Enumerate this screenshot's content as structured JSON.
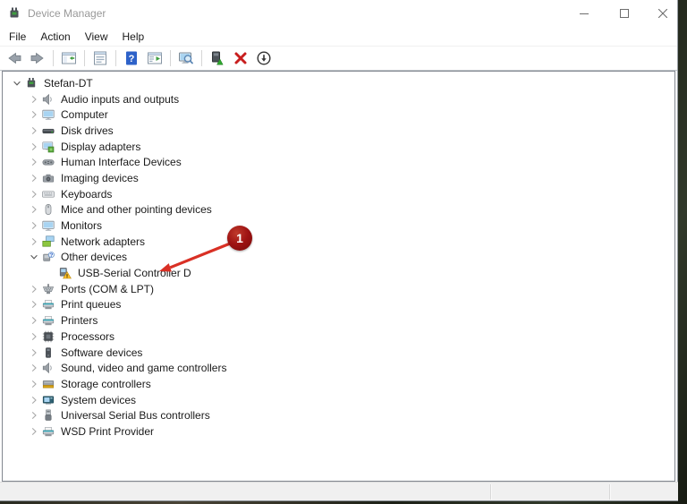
{
  "window": {
    "title": "Device Manager",
    "title_icon": "device-manager-icon"
  },
  "menu": {
    "items": [
      "File",
      "Action",
      "View",
      "Help"
    ]
  },
  "toolbar": {
    "groups": [
      [
        {
          "name": "back-button",
          "icon": "arrow-left-icon"
        },
        {
          "name": "forward-button",
          "icon": "arrow-right-icon"
        }
      ],
      [
        {
          "name": "show-console-tree-button",
          "icon": "console-tree-icon"
        }
      ],
      [
        {
          "name": "properties-button",
          "icon": "properties-icon"
        }
      ],
      [
        {
          "name": "help-button",
          "icon": "help-icon"
        },
        {
          "name": "show-action-pane-button",
          "icon": "action-pane-icon"
        }
      ],
      [
        {
          "name": "scan-hardware-changes-button",
          "icon": "scan-hardware-icon"
        }
      ],
      [
        {
          "name": "update-driver-button",
          "icon": "update-driver-icon"
        },
        {
          "name": "uninstall-device-button",
          "icon": "uninstall-icon"
        },
        {
          "name": "disable-device-button",
          "icon": "disable-device-icon"
        }
      ]
    ]
  },
  "tree": {
    "items": [
      {
        "label": "Stefan-DT",
        "level": 0,
        "state": "expanded",
        "icon": "computer-root-icon"
      },
      {
        "label": "Audio inputs and outputs",
        "level": 1,
        "state": "collapsed",
        "icon": "audio-icon"
      },
      {
        "label": "Computer",
        "level": 1,
        "state": "collapsed",
        "icon": "computer-icon"
      },
      {
        "label": "Disk drives",
        "level": 1,
        "state": "collapsed",
        "icon": "disk-drive-icon"
      },
      {
        "label": "Display adapters",
        "level": 1,
        "state": "collapsed",
        "icon": "display-adapter-icon"
      },
      {
        "label": "Human Interface Devices",
        "level": 1,
        "state": "collapsed",
        "icon": "hid-icon"
      },
      {
        "label": "Imaging devices",
        "level": 1,
        "state": "collapsed",
        "icon": "imaging-icon"
      },
      {
        "label": "Keyboards",
        "level": 1,
        "state": "collapsed",
        "icon": "keyboard-icon"
      },
      {
        "label": "Mice and other pointing devices",
        "level": 1,
        "state": "collapsed",
        "icon": "mouse-icon"
      },
      {
        "label": "Monitors",
        "level": 1,
        "state": "collapsed",
        "icon": "monitor-icon"
      },
      {
        "label": "Network adapters",
        "level": 1,
        "state": "collapsed",
        "icon": "network-icon"
      },
      {
        "label": "Other devices",
        "level": 1,
        "state": "expanded",
        "icon": "other-devices-icon"
      },
      {
        "label": "USB-Serial Controller D",
        "level": 2,
        "state": "leaf",
        "icon": "unknown-device-warning-icon"
      },
      {
        "label": "Ports (COM & LPT)",
        "level": 1,
        "state": "collapsed",
        "icon": "serial-port-icon"
      },
      {
        "label": "Print queues",
        "level": 1,
        "state": "collapsed",
        "icon": "printer-icon"
      },
      {
        "label": "Printers",
        "level": 1,
        "state": "collapsed",
        "icon": "printer-icon"
      },
      {
        "label": "Processors",
        "level": 1,
        "state": "collapsed",
        "icon": "processor-icon"
      },
      {
        "label": "Software devices",
        "level": 1,
        "state": "collapsed",
        "icon": "software-device-icon"
      },
      {
        "label": "Sound, video and game controllers",
        "level": 1,
        "state": "collapsed",
        "icon": "sound-icon"
      },
      {
        "label": "Storage controllers",
        "level": 1,
        "state": "collapsed",
        "icon": "storage-icon"
      },
      {
        "label": "System devices",
        "level": 1,
        "state": "collapsed",
        "icon": "system-devices-icon"
      },
      {
        "label": "Universal Serial Bus controllers",
        "level": 1,
        "state": "collapsed",
        "icon": "usb-icon"
      },
      {
        "label": "WSD Print Provider",
        "level": 1,
        "state": "collapsed",
        "icon": "printer-icon"
      }
    ]
  },
  "annotation": {
    "label": "1",
    "circle_color": "#9e1212",
    "arrow_color": "#d93025"
  },
  "colors": {
    "title_text": "#999999",
    "tree_text": "#1a1a1a",
    "warning_yellow": "#fbc02d",
    "uninstall_red": "#c81e1e",
    "help_blue": "#2e62c9"
  }
}
